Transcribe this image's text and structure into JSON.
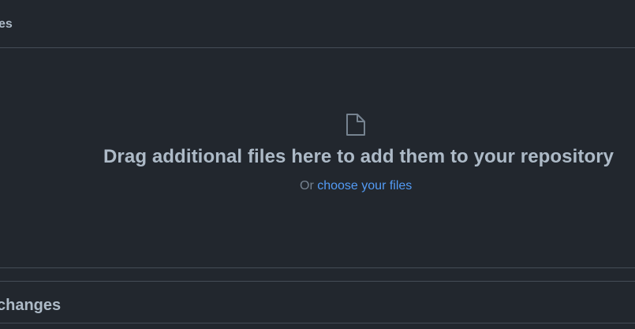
{
  "header": {
    "title": "es"
  },
  "dropzone": {
    "icon": "file-icon",
    "heading": "Drag additional files here to add them to your repository",
    "or_text": "Or",
    "choose_link": "choose your files"
  },
  "commit": {
    "title": "changes"
  },
  "colors": {
    "background": "#22272e",
    "border": "#444c56",
    "text": "#adbac7",
    "muted": "#768390",
    "link": "#539bf5"
  }
}
